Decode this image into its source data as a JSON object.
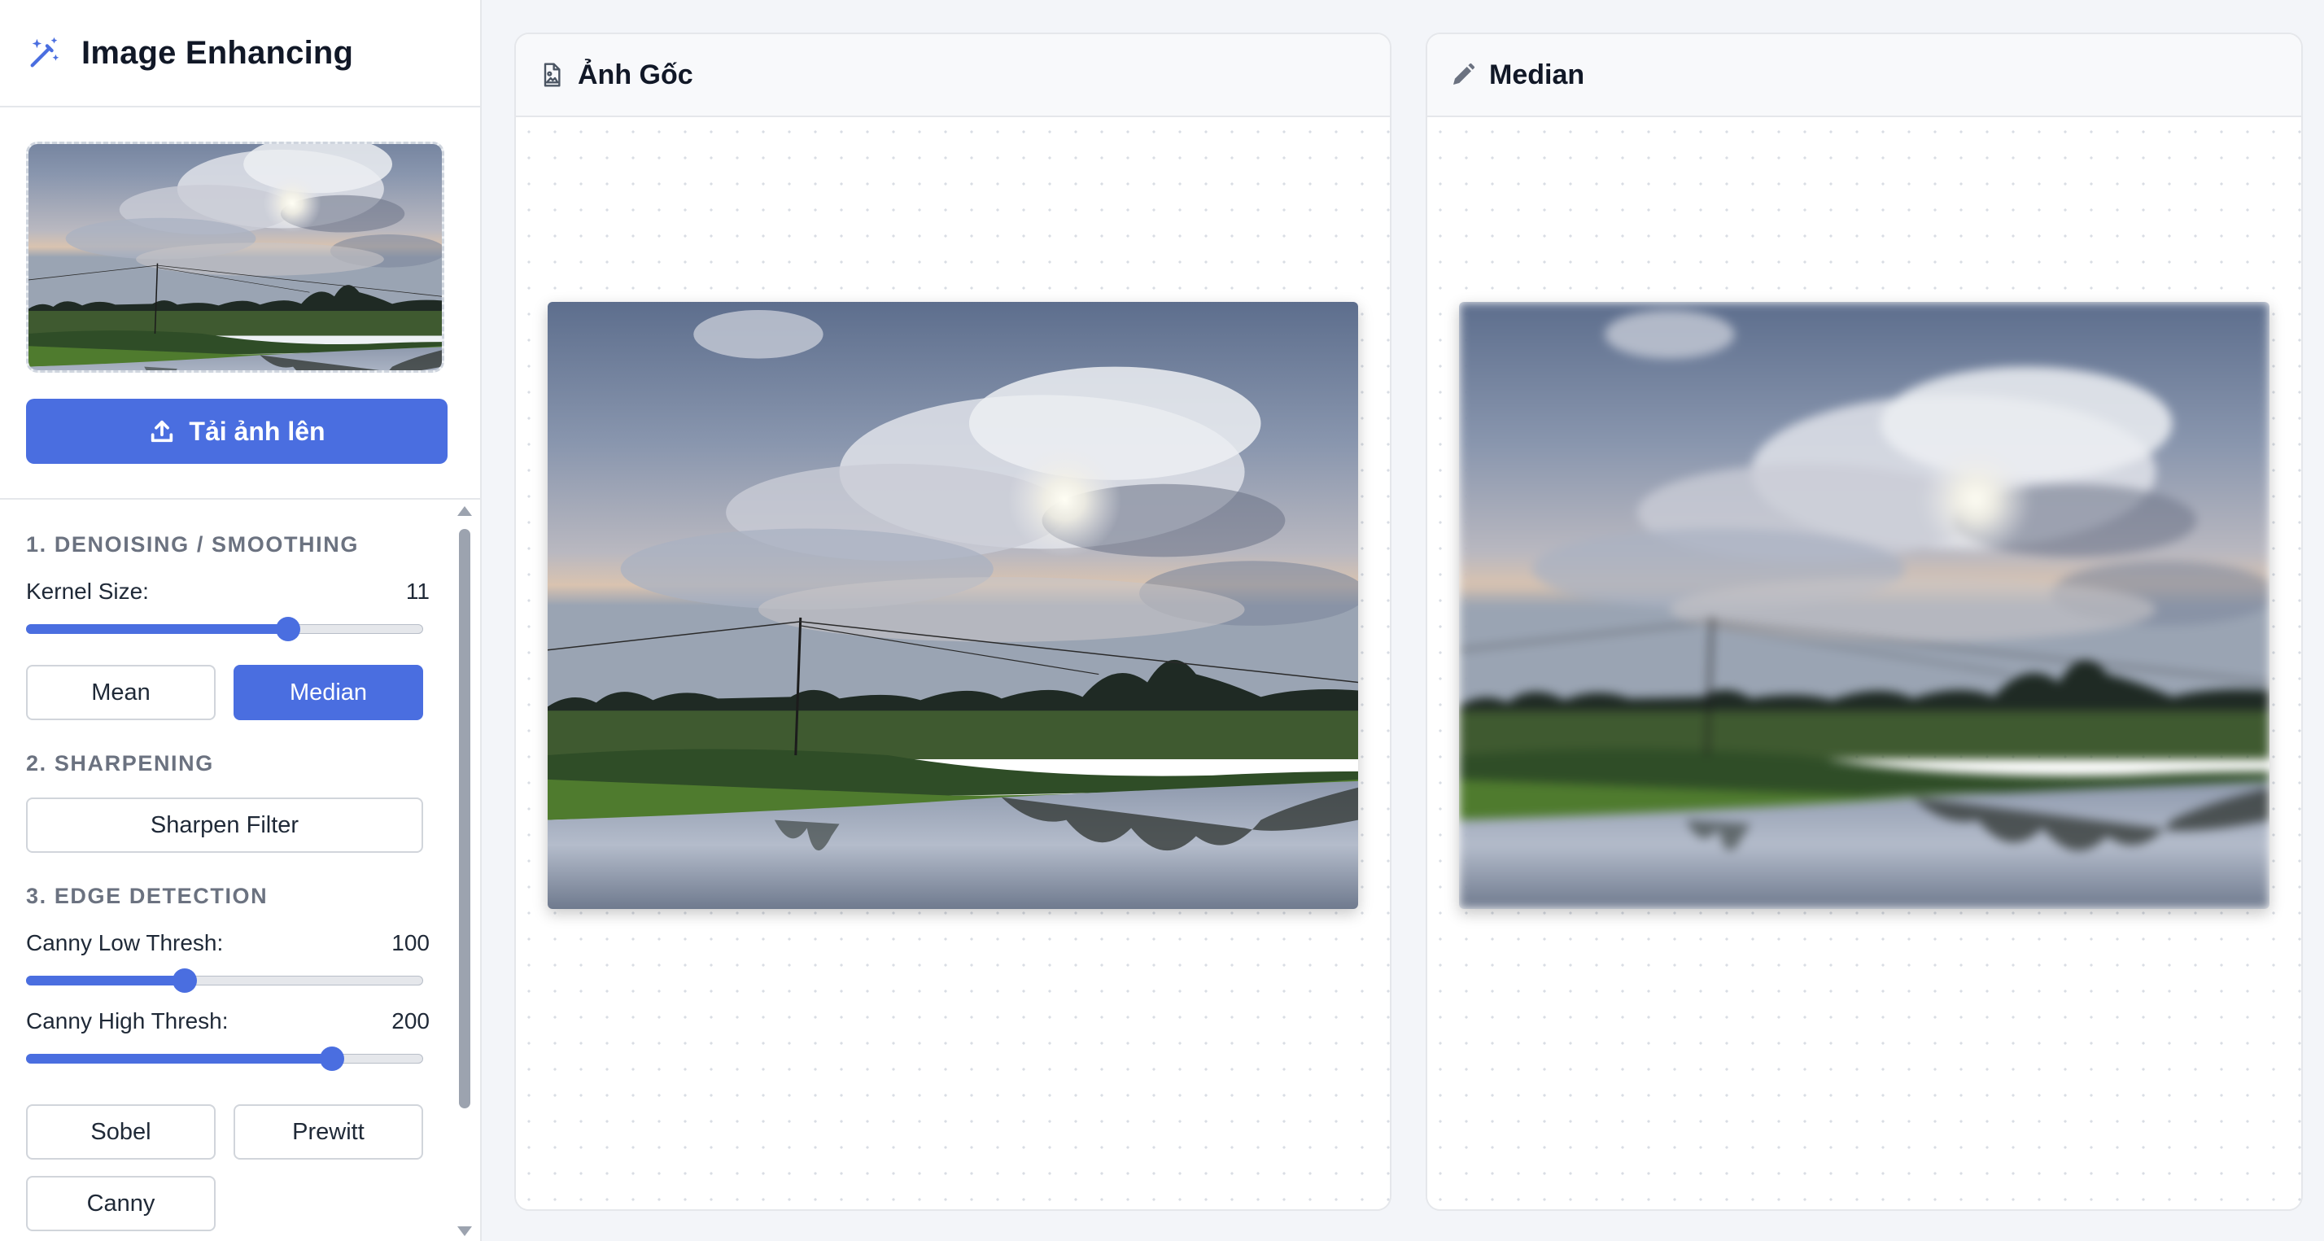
{
  "app": {
    "title": "Image Enhancing",
    "upload_label": "Tải ảnh lên"
  },
  "denoise": {
    "title": "1. DENOISING / SMOOTHING",
    "kernel_label": "Kernel Size:",
    "kernel_value": "11",
    "kernel_fraction": 0.66,
    "mean_label": "Mean",
    "median_label": "Median",
    "active": "Median"
  },
  "sharpen": {
    "title": "2. SHARPENING",
    "filter_label": "Sharpen Filter"
  },
  "edge": {
    "title": "3. EDGE DETECTION",
    "low_label": "Canny Low Thresh:",
    "low_value": "100",
    "low_fraction": 0.4,
    "high_label": "Canny High Thresh:",
    "high_value": "200",
    "high_fraction": 0.77,
    "sobel_label": "Sobel",
    "prewitt_label": "Prewitt",
    "canny_label": "Canny"
  },
  "panels": {
    "original_title": "Ảnh Gốc",
    "result_title": "Median"
  },
  "colors": {
    "accent": "#4a6ee0"
  },
  "icons": {
    "brand": "magic-wand-icon",
    "upload": "upload-icon",
    "original": "image-file-icon",
    "result": "pencil-icon"
  }
}
